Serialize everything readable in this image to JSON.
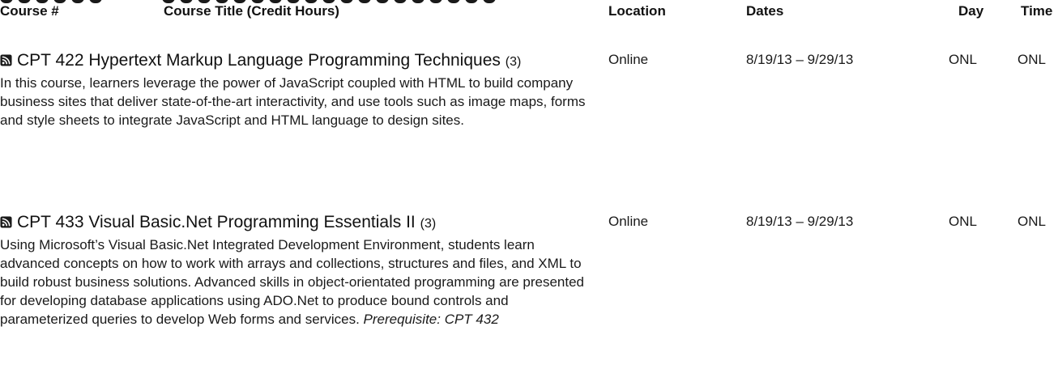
{
  "header": {
    "course_num": "Course #",
    "course_title": "Course Title (Credit Hours)",
    "location": "Location",
    "dates": "Dates",
    "day": "Day",
    "time": "Time"
  },
  "icons": {
    "feed": "rss-feed-icon"
  },
  "courses": [
    {
      "code_title": "CPT 422 Hypertext Markup Language Programming Techniques",
      "credits": "(3)",
      "description": "In this course, learners leverage the power of JavaScript coupled with HTML to build company business sites that deliver state-of-the-art interactivity, and use tools such as image maps, forms and style sheets to integrate JavaScript and HTML language to design sites.",
      "location": "Online",
      "dates": "8/19/13 – 9/29/13",
      "day": "ONL",
      "time": "ONL"
    },
    {
      "code_title": "CPT 433 Visual Basic.Net Programming Essentials II",
      "credits": "(3)",
      "description": "Using Microsoft’s Visual Basic.Net Integrated Development Environment, students learn advanced concepts on how to work with arrays and collections, structures  and files, and XML to build robust business solutions. Advanced skills in object-orientated programming are presented for developing database applications using ADO.Net to produce bound controls and parameterized queries to develop Web forms and services.",
      "prerequisite": "Prerequisite: CPT 432",
      "location": "Online",
      "dates": "8/19/13 – 9/29/13",
      "day": "ONL",
      "time": "ONL"
    }
  ]
}
